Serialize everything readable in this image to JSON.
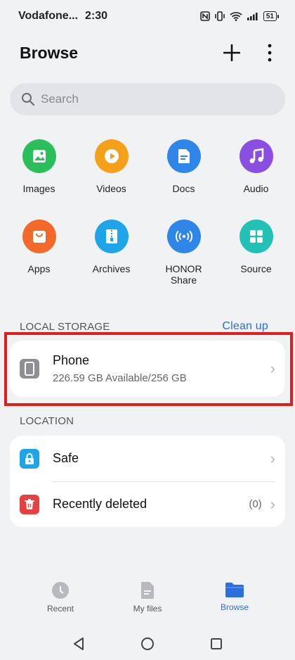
{
  "status_bar": {
    "carrier": "Vodafone...",
    "time": "2:30",
    "battery": "51"
  },
  "header": {
    "title": "Browse",
    "add_icon": "plus-icon",
    "more_icon": "more-vertical-icon"
  },
  "search": {
    "placeholder": "Search"
  },
  "categories": [
    {
      "label": "Images",
      "icon": "image-icon",
      "color": "#2bbf5a"
    },
    {
      "label": "Videos",
      "icon": "play-icon",
      "color": "#f5a019"
    },
    {
      "label": "Docs",
      "icon": "document-icon",
      "color": "#2e86e9"
    },
    {
      "label": "Audio",
      "icon": "music-icon",
      "color": "#8a4fe0"
    },
    {
      "label": "Apps",
      "icon": "shopping-bag-icon",
      "color": "#f2692a"
    },
    {
      "label": "Archives",
      "icon": "archive-icon",
      "color": "#1ea4e8"
    },
    {
      "label": "HONOR Share",
      "icon": "wireless-share-icon",
      "color": "#2e86e9"
    },
    {
      "label": "Source",
      "icon": "grid-icon",
      "color": "#22c1b6"
    }
  ],
  "local_storage": {
    "heading": "LOCAL STORAGE",
    "action": "Clean up",
    "phone": {
      "name": "Phone",
      "detail": "226.59 GB Available/256 GB"
    }
  },
  "location": {
    "heading": "LOCATION",
    "items": [
      {
        "name": "Safe",
        "icon": "lock-icon",
        "color": "#1ea4e8",
        "count": ""
      },
      {
        "name": "Recently deleted",
        "icon": "trash-icon",
        "color": "#e64040",
        "count": "(0)"
      }
    ]
  },
  "tabs": [
    {
      "label": "Recent",
      "icon": "clock-icon",
      "active": false
    },
    {
      "label": "My files",
      "icon": "file-icon",
      "active": false
    },
    {
      "label": "Browse",
      "icon": "folder-icon",
      "active": true
    }
  ],
  "colors": {
    "accent": "#2a6fdb",
    "highlight_border": "#e01e1e",
    "background": "#f1f2f4"
  }
}
